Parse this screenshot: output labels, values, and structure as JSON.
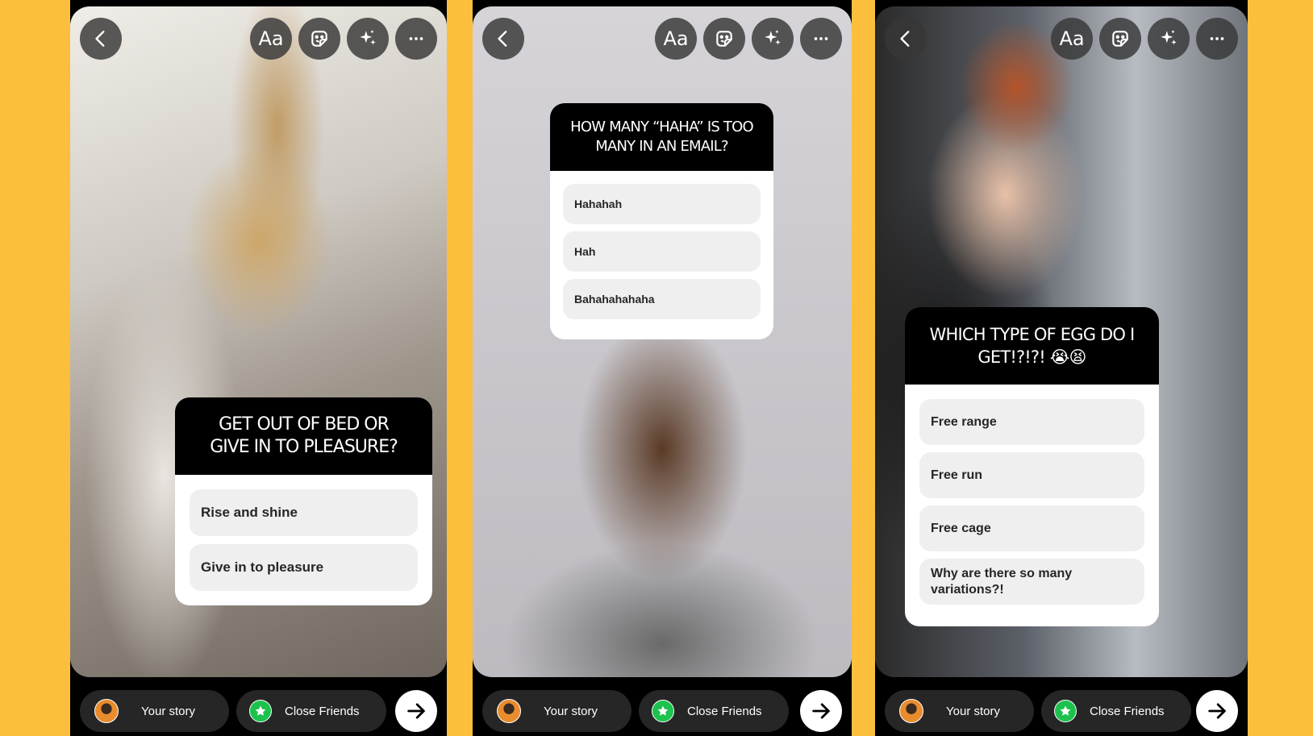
{
  "colors": {
    "background": "#FBBF3D",
    "close_friends_green": "#1CC24D"
  },
  "toolbar": {
    "text_tool_label": "Aa",
    "icons": [
      "chevron-left-icon",
      "sticker-icon",
      "sparkles-icon",
      "more-icon"
    ]
  },
  "bottom": {
    "your_story_label": "Your story",
    "close_friends_label": "Close Friends"
  },
  "screens": [
    {
      "poll": {
        "question_line1": "GET OUT OF BED OR",
        "question_line2": "GIVE IN TO PLEASURE?",
        "options": [
          "Rise and shine",
          "Give in to pleasure"
        ]
      }
    },
    {
      "poll": {
        "question_line1": "HOW MANY “HAHA” IS TOO",
        "question_line2": "MANY IN AN EMAIL?",
        "options": [
          "Hahahah",
          "Hah",
          "Bahahahahaha"
        ]
      }
    },
    {
      "poll": {
        "question_line1": "WHICH TYPE OF EGG DO I",
        "question_line2": "GET!?!?! 😭😫",
        "options": [
          "Free range",
          "Free run",
          "Free cage",
          "Why are there so many variations?!"
        ]
      }
    }
  ]
}
